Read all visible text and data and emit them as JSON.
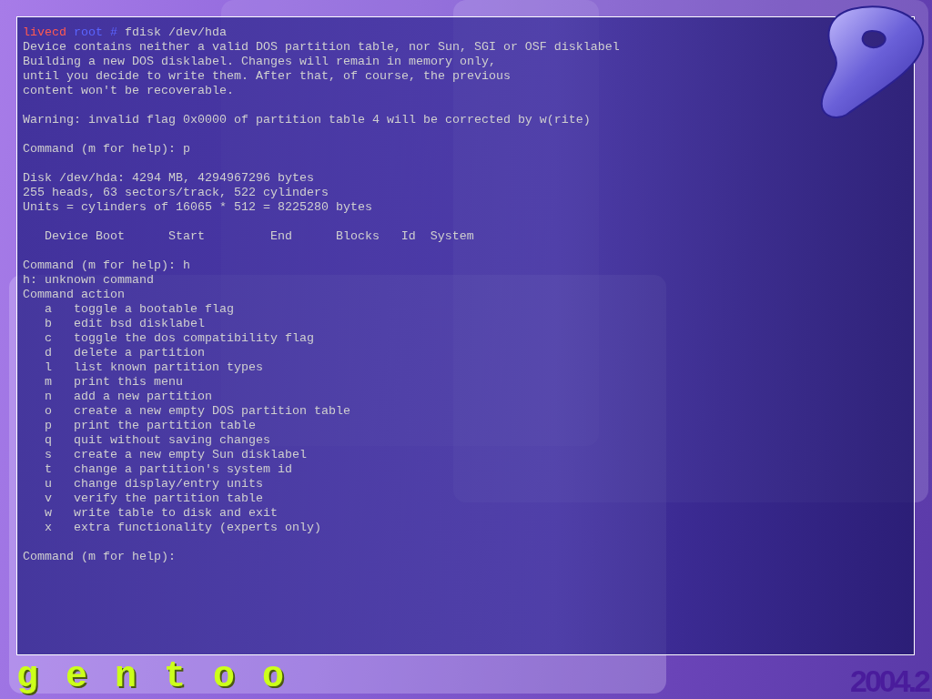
{
  "console": {
    "blocks": [
      {
        "lines": [
          {
            "kind": "prompt",
            "host": "livecd",
            "user": "root",
            "symbol": "#",
            "command": "fdisk /dev/hda"
          },
          {
            "kind": "text",
            "text": "Device contains neither a valid DOS partition table, nor Sun, SGI or OSF disklabel"
          },
          {
            "kind": "text",
            "text": "Building a new DOS disklabel. Changes will remain in memory only,"
          },
          {
            "kind": "text",
            "text": "until you decide to write them. After that, of course, the previous"
          },
          {
            "kind": "text",
            "text": "content won't be recoverable."
          }
        ]
      },
      {
        "lines": [
          {
            "kind": "text",
            "text": "Warning: invalid flag 0x0000 of partition table 4 will be corrected by w(rite)"
          }
        ]
      },
      {
        "lines": [
          {
            "kind": "text",
            "text": "Command (m for help): p"
          }
        ]
      },
      {
        "lines": [
          {
            "kind": "text",
            "text": "Disk /dev/hda: 4294 MB, 4294967296 bytes"
          },
          {
            "kind": "text",
            "text": "255 heads, 63 sectors/track, 522 cylinders"
          },
          {
            "kind": "text",
            "text": "Units = cylinders of 16065 * 512 = 8225280 bytes"
          }
        ]
      },
      {
        "lines": [
          {
            "kind": "header",
            "columns": [
              "Device Boot",
              "Start",
              "End",
              "Blocks",
              "Id",
              "System"
            ]
          }
        ]
      },
      {
        "lines": [
          {
            "kind": "text",
            "text": "Command (m for help): h"
          },
          {
            "kind": "text",
            "text": "h: unknown command"
          },
          {
            "kind": "text",
            "text": "Command action"
          },
          {
            "kind": "menu",
            "key": "a",
            "action": "toggle a bootable flag"
          },
          {
            "kind": "menu",
            "key": "b",
            "action": "edit bsd disklabel"
          },
          {
            "kind": "menu",
            "key": "c",
            "action": "toggle the dos compatibility flag"
          },
          {
            "kind": "menu",
            "key": "d",
            "action": "delete a partition"
          },
          {
            "kind": "menu",
            "key": "l",
            "action": "list known partition types"
          },
          {
            "kind": "menu",
            "key": "m",
            "action": "print this menu"
          },
          {
            "kind": "menu",
            "key": "n",
            "action": "add a new partition"
          },
          {
            "kind": "menu",
            "key": "o",
            "action": "create a new empty DOS partition table"
          },
          {
            "kind": "menu",
            "key": "p",
            "action": "print the partition table"
          },
          {
            "kind": "menu",
            "key": "q",
            "action": "quit without saving changes"
          },
          {
            "kind": "menu",
            "key": "s",
            "action": "create a new empty Sun disklabel"
          },
          {
            "kind": "menu",
            "key": "t",
            "action": "change a partition's system id"
          },
          {
            "kind": "menu",
            "key": "u",
            "action": "change display/entry units"
          },
          {
            "kind": "menu",
            "key": "v",
            "action": "verify the partition table"
          },
          {
            "kind": "menu",
            "key": "w",
            "action": "write table to disk and exit"
          },
          {
            "kind": "menu",
            "key": "x",
            "action": "extra functionality (experts only)"
          }
        ]
      },
      {
        "lines": [
          {
            "kind": "text",
            "text": "Command (m for help):"
          }
        ]
      }
    ]
  },
  "logo": "gentoo",
  "version": "2004.2"
}
